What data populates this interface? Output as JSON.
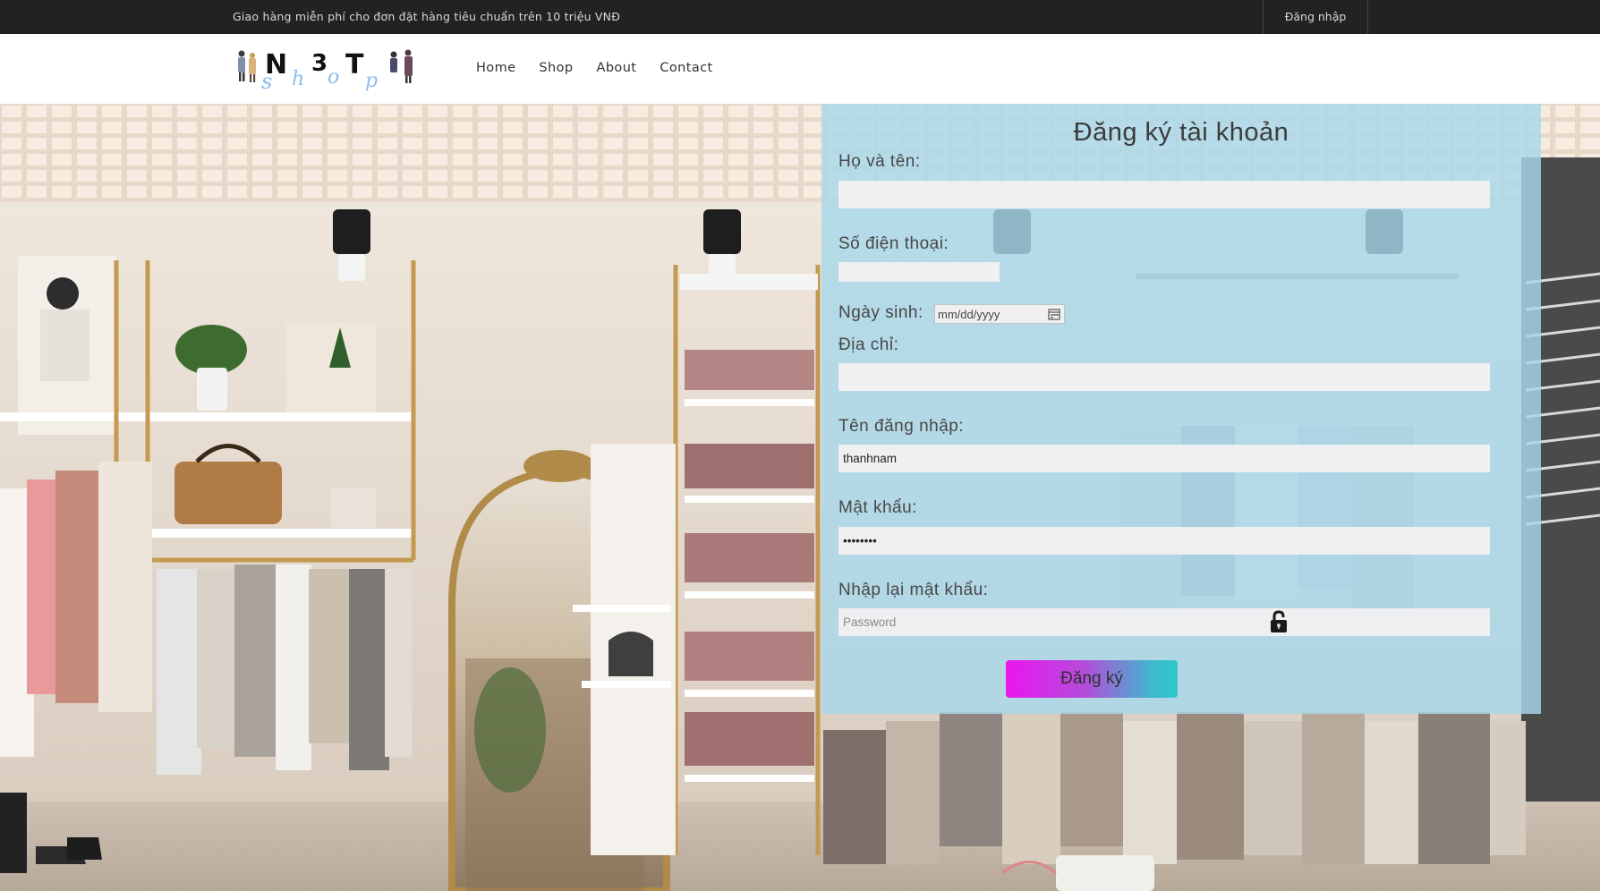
{
  "topbar": {
    "notice": "Giao hàng miễn phí cho đơn đặt hàng tiêu chuẩn trên 10 triệu VNĐ",
    "login_label": "Đăng nhập"
  },
  "header": {
    "logo_text": "N3T",
    "logo_script": "shop",
    "nav": [
      "Home",
      "Shop",
      "About",
      "Contact"
    ]
  },
  "form": {
    "title": "Đăng ký tài khoản",
    "fullname": {
      "label": "Họ và tên:",
      "value": ""
    },
    "phone": {
      "label": "Số điện thoại:",
      "value": ""
    },
    "dob": {
      "label": "Ngày sinh:",
      "placeholder": "mm/dd/yyyy"
    },
    "address": {
      "label": "Địa chỉ:",
      "value": ""
    },
    "username": {
      "label": "Tên đăng nhập:",
      "value": "thanhnam"
    },
    "password": {
      "label": "Mật khẩu:",
      "value": "••••••••"
    },
    "confirm": {
      "label": "Nhập lại mật khẩu:",
      "placeholder": "Password"
    },
    "submit_label": "Đăng ký"
  },
  "colors": {
    "topbar": "#222222",
    "panel": "#a8d8ea",
    "button_gradient_start": "#ea16f0",
    "button_gradient_end": "#2cc9c8"
  }
}
